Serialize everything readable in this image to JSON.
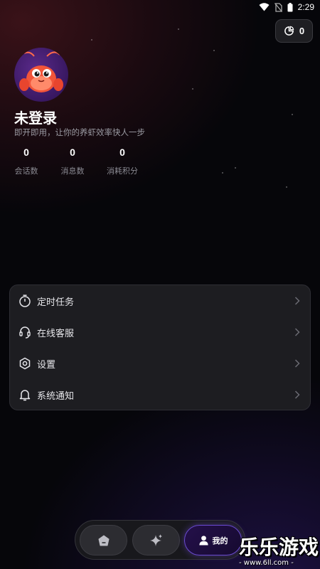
{
  "status_bar": {
    "time": "2:29",
    "icons": [
      "wifi-icon",
      "no-sim-icon",
      "battery-icon"
    ]
  },
  "points_badge": {
    "icon": "points-icon",
    "value": "0"
  },
  "profile": {
    "avatar": "lobster-mascot",
    "name": "未登录",
    "slogan": "即开即用，让你的养虾效率快人一步"
  },
  "stats": [
    {
      "value": "0",
      "label": "会话数"
    },
    {
      "value": "0",
      "label": "消息数"
    },
    {
      "value": "0",
      "label": "消耗积分"
    }
  ],
  "menu": [
    {
      "icon": "timer-icon",
      "label": "定时任务"
    },
    {
      "icon": "headset-icon",
      "label": "在线客服"
    },
    {
      "icon": "settings-hexagon-icon",
      "label": "设置"
    },
    {
      "icon": "bell-icon",
      "label": "系统通知"
    }
  ],
  "bottom_nav": {
    "items": [
      {
        "icon": "home-icon",
        "label": ""
      },
      {
        "icon": "sparkle-icon",
        "label": ""
      },
      {
        "icon": "person-icon",
        "label": "我的"
      }
    ],
    "active": "我的"
  },
  "watermark": {
    "main": "乐乐游戏",
    "sub": "- www.6ll.com -"
  },
  "colors": {
    "background": "#06060a",
    "card": "#1d1d21",
    "active_glow": "#6a4ad0"
  }
}
